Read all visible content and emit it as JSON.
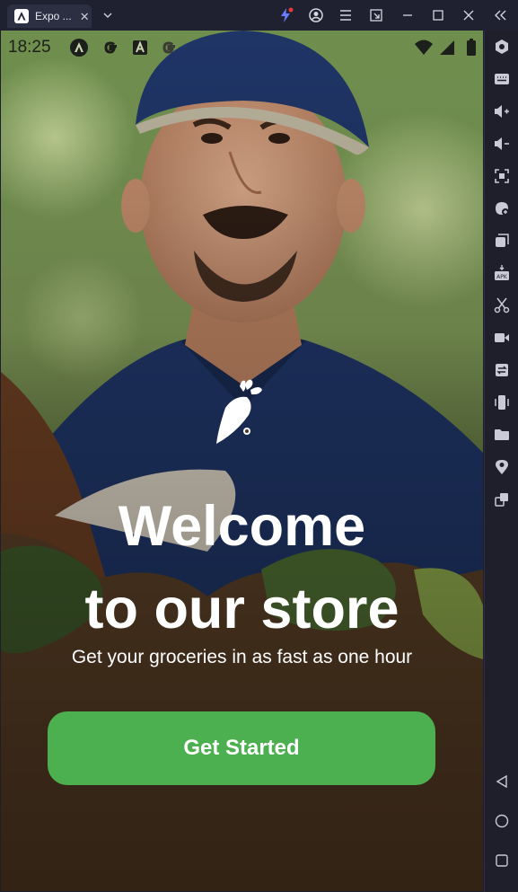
{
  "window": {
    "tab_title": "Expo ...",
    "tab_close": "✕",
    "colors": {
      "titlebar": "#1f2030",
      "tab": "#2c2e42",
      "accent_red": "#e53935"
    }
  },
  "device": {
    "status_bar": {
      "time": "18:25"
    }
  },
  "screen": {
    "headline_line1": "Welcome",
    "headline_line2": "to our store",
    "subtitle": "Get your groceries in as fast as one hour",
    "cta_label": "Get Started",
    "colors": {
      "cta": "#4caf50",
      "text": "#ffffff"
    }
  },
  "side_toolbar": {
    "icons": [
      "hexagon-icon",
      "keyboard-icon",
      "volume-up-icon",
      "volume-down-icon",
      "screenshot-icon",
      "rotate-icon",
      "multi-window-icon",
      "apk-install-icon",
      "scissors-icon",
      "record-video-icon",
      "sync-icon",
      "shake-icon",
      "folder-icon",
      "location-icon",
      "resize-icon",
      "back-icon",
      "home-icon",
      "recents-icon"
    ]
  }
}
